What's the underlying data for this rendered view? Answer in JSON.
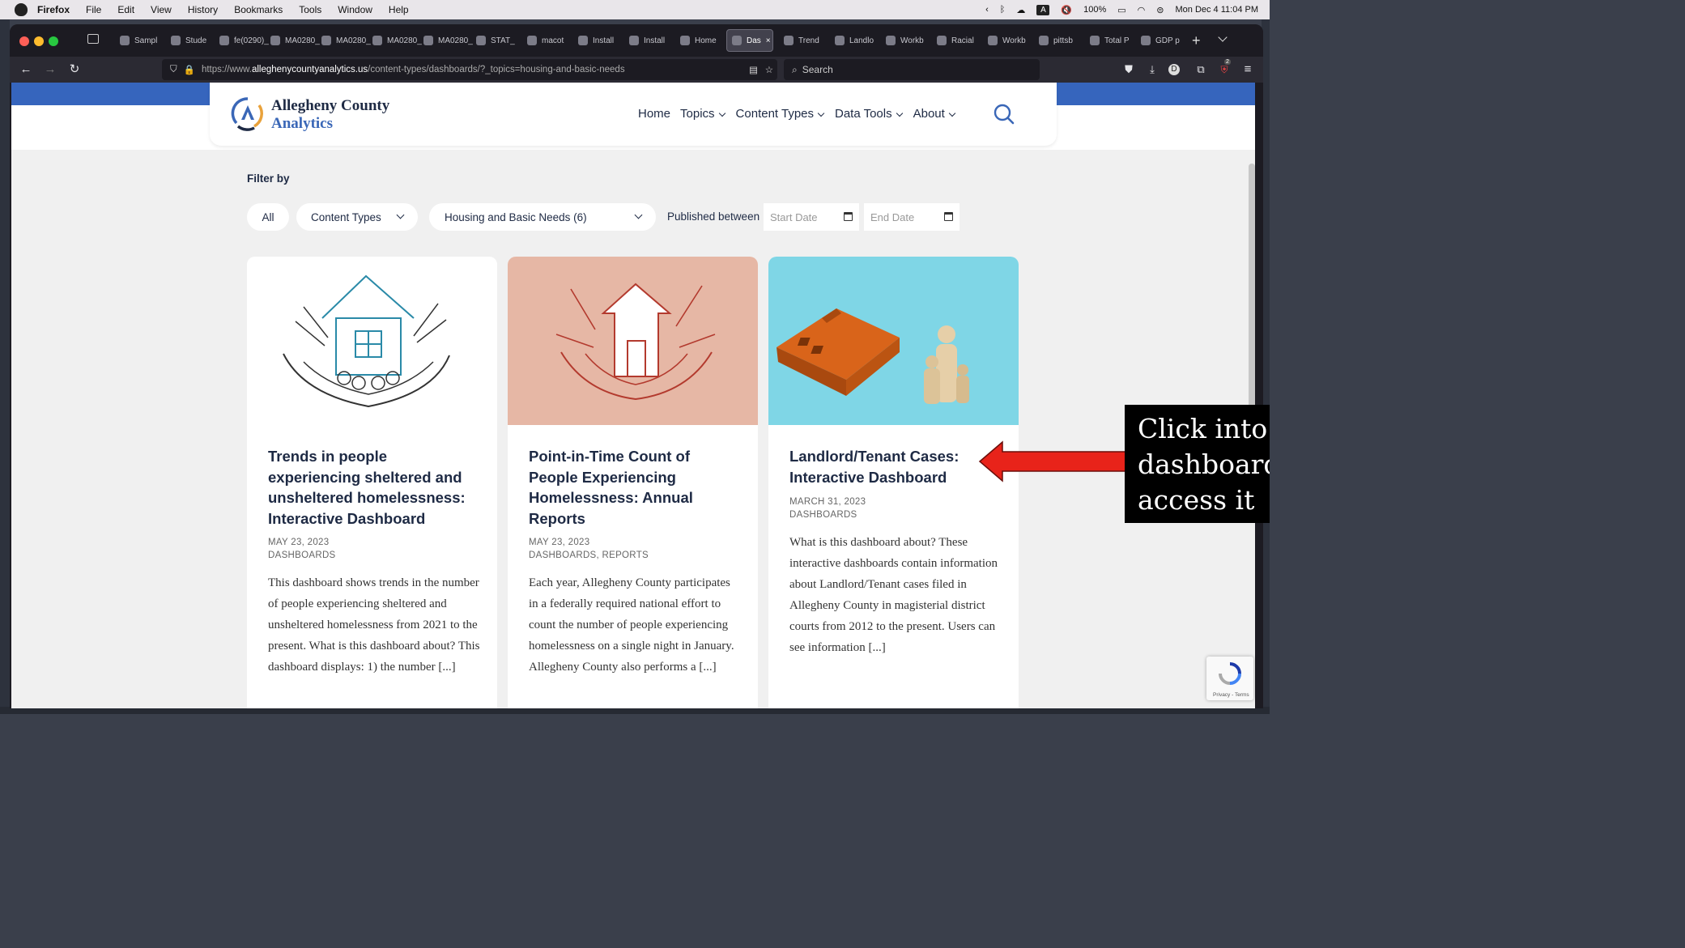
{
  "menubar": {
    "app": "Firefox",
    "items": [
      "File",
      "Edit",
      "View",
      "History",
      "Bookmarks",
      "Tools",
      "Window",
      "Help"
    ],
    "battery": "100%",
    "datetime": "Mon Dec 4  11:04 PM",
    "input_source": "A"
  },
  "tabs": [
    {
      "label": "Sampl",
      "icon": "shield-icon"
    },
    {
      "label": "Stude",
      "icon": "circle-icon"
    },
    {
      "label": "fe(0290)_",
      "icon": "doc-icon"
    },
    {
      "label": "MA0280_",
      "icon": "doc-icon"
    },
    {
      "label": "MA0280_",
      "icon": "doc-icon"
    },
    {
      "label": "MA0280_",
      "icon": "doc-icon"
    },
    {
      "label": "MA0280_",
      "icon": "doc-icon"
    },
    {
      "label": "STAT_",
      "icon": "shield-icon"
    },
    {
      "label": "macot",
      "icon": "x-icon"
    },
    {
      "label": "Install",
      "icon": "github-icon"
    },
    {
      "label": "Install",
      "icon": "github-icon"
    },
    {
      "label": "Home",
      "icon": "github-icon"
    },
    {
      "label": "Das",
      "icon": "acanalytics-icon",
      "active": true
    },
    {
      "label": "Trend",
      "icon": "acanalytics-icon"
    },
    {
      "label": "Landlo",
      "icon": "acanalytics-icon"
    },
    {
      "label": "Workb",
      "icon": "tableau-icon"
    },
    {
      "label": "Racial",
      "icon": "acanalytics-icon"
    },
    {
      "label": "Workb",
      "icon": "tableau-icon"
    },
    {
      "label": "pittsb",
      "icon": "google-icon"
    },
    {
      "label": "Total P",
      "icon": "chart-icon"
    },
    {
      "label": "GDP p",
      "icon": "globe-icon"
    }
  ],
  "address": {
    "prefix": "https://www.",
    "domain": "alleghenycountyanalytics.us",
    "path": "/content-types/dashboards/?_topics=housing-and-basic-needs"
  },
  "search_placeholder": "Search",
  "toolbar_badge": "2",
  "site": {
    "logo_line1": "Allegheny County",
    "logo_line2": "Analytics",
    "nav": [
      {
        "label": "Home",
        "dropdown": false
      },
      {
        "label": "Topics",
        "dropdown": true
      },
      {
        "label": "Content Types",
        "dropdown": true
      },
      {
        "label": "Data Tools",
        "dropdown": true
      },
      {
        "label": "About",
        "dropdown": true
      }
    ]
  },
  "filters": {
    "label": "Filter by",
    "all": "All",
    "content_types": "Content Types",
    "topic": "Housing and Basic Needs (6)",
    "published_between": "Published between",
    "start_placeholder": "Start Date",
    "end_placeholder": "End Date"
  },
  "cards": [
    {
      "title": "Trends in people experiencing sheltered and unsheltered homelessness: Interactive Dashboard",
      "date": "MAY 23, 2023",
      "category": "DASHBOARDS",
      "excerpt": "This dashboard shows trends in the number of people experiencing sheltered and unsheltered homelessness from 2021 to the present. What is this dashboard about? This dashboard displays: 1) the number [...]",
      "image_bg": "#ffffff"
    },
    {
      "title": "Point-in-Time Count of People Experiencing Homelessness: Annual Reports",
      "date": "MAY 23, 2023",
      "category": "DASHBOARDS, REPORTS",
      "excerpt": "Each year, Allegheny County participates in a federally required national effort to count the number of people experiencing homelessness on a single night in January. Allegheny County also performs a [...]",
      "image_bg": "#e6b7a5"
    },
    {
      "title": "Landlord/Tenant Cases: Interactive Dashboard",
      "date": "MARCH 31, 2023",
      "category": "DASHBOARDS",
      "excerpt": "What is this dashboard about? These interactive dashboards contain information about Landlord/Tenant cases filed in Allegheny County in magisterial district courts from 2012 to the present. Users can see information [...]",
      "image_bg": "#7fd6e6"
    }
  ],
  "annotation": {
    "text": "Click into\ndashboard\naccess it",
    "arrow_color": "#e8231a"
  },
  "recaptcha": "Privacy - Terms",
  "colors": {
    "brand_blue": "#3665bd",
    "navy": "#1e2a44"
  }
}
